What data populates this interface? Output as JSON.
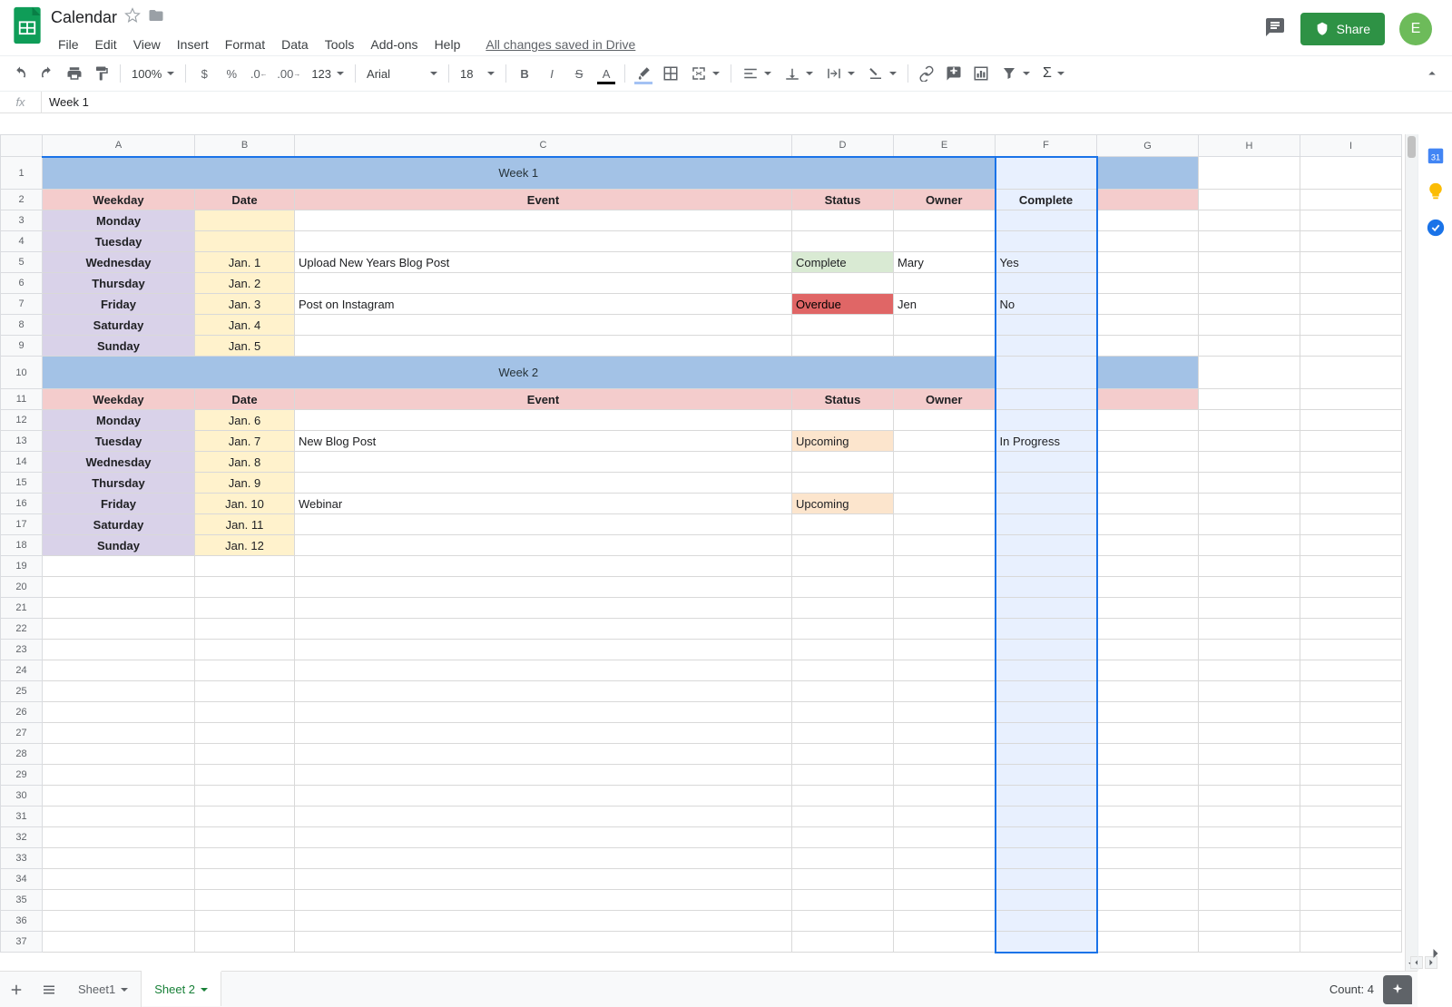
{
  "doc": {
    "title": "Calendar",
    "drive_status": "All changes saved in Drive",
    "avatar_letter": "E",
    "share_label": "Share"
  },
  "menu": [
    "File",
    "Edit",
    "View",
    "Insert",
    "Format",
    "Data",
    "Tools",
    "Add-ons",
    "Help"
  ],
  "toolbar": {
    "zoom": "100%",
    "font": "Arial",
    "size": "18",
    "number_fmt": "123"
  },
  "formula_bar": {
    "label": "fx",
    "value": "Week 1"
  },
  "columns": [
    "A",
    "B",
    "C",
    "D",
    "E",
    "F",
    "G",
    "H",
    "I"
  ],
  "selected_col": "F",
  "row_count": 37,
  "footer": {
    "tab1": "Sheet1",
    "tab2": "Sheet 2",
    "counter_label": "Count:",
    "counter_value": "4"
  },
  "headers": {
    "weekday": "Weekday",
    "date": "Date",
    "event": "Event",
    "status": "Status",
    "owner": "Owner",
    "complete": "Complete"
  },
  "week1": {
    "title": "Week 1",
    "rows": [
      {
        "wday": "Monday",
        "date": "",
        "event": "",
        "status": "",
        "statusCls": "",
        "owner": "",
        "complete": ""
      },
      {
        "wday": "Tuesday",
        "date": "",
        "event": "",
        "status": "",
        "statusCls": "",
        "owner": "",
        "complete": ""
      },
      {
        "wday": "Wednesday",
        "date": "Jan. 1",
        "event": "Upload New Years Blog Post",
        "status": "Complete",
        "statusCls": "status-complete",
        "owner": "Mary",
        "complete": "Yes"
      },
      {
        "wday": "Thursday",
        "date": "Jan. 2",
        "event": "",
        "status": "",
        "statusCls": "",
        "owner": "",
        "complete": ""
      },
      {
        "wday": "Friday",
        "date": "Jan. 3",
        "event": "Post on Instagram",
        "status": "Overdue",
        "statusCls": "status-overdue",
        "owner": "Jen",
        "complete": "No"
      },
      {
        "wday": "Saturday",
        "date": "Jan. 4",
        "event": "",
        "status": "",
        "statusCls": "",
        "owner": "",
        "complete": ""
      },
      {
        "wday": "Sunday",
        "date": "Jan. 5",
        "event": "",
        "status": "",
        "statusCls": "",
        "owner": "",
        "complete": ""
      }
    ]
  },
  "week2": {
    "title": "Week 2",
    "rows": [
      {
        "wday": "Monday",
        "date": "Jan. 6",
        "event": "",
        "status": "",
        "statusCls": "",
        "owner": "",
        "complete": ""
      },
      {
        "wday": "Tuesday",
        "date": "Jan. 7",
        "event": "New Blog Post",
        "status": "Upcoming",
        "statusCls": "status-upcoming",
        "owner": "",
        "complete": "In Progress"
      },
      {
        "wday": "Wednesday",
        "date": "Jan. 8",
        "event": "",
        "status": "",
        "statusCls": "",
        "owner": "",
        "complete": ""
      },
      {
        "wday": "Thursday",
        "date": "Jan. 9",
        "event": "",
        "status": "",
        "statusCls": "",
        "owner": "",
        "complete": ""
      },
      {
        "wday": "Friday",
        "date": "Jan. 10",
        "event": "Webinar",
        "status": "Upcoming",
        "statusCls": "status-upcoming",
        "owner": "",
        "complete": ""
      },
      {
        "wday": "Saturday",
        "date": "Jan. 11",
        "event": "",
        "status": "",
        "statusCls": "",
        "owner": "",
        "complete": ""
      },
      {
        "wday": "Sunday",
        "date": "Jan. 12",
        "event": "",
        "status": "",
        "statusCls": "",
        "owner": "",
        "complete": ""
      }
    ]
  }
}
